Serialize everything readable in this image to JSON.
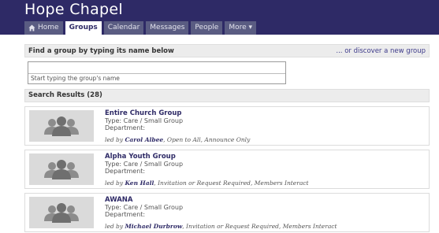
{
  "site": {
    "title": "Hope Chapel"
  },
  "nav": {
    "tabs": [
      {
        "label": "Home",
        "icon": "home-icon"
      },
      {
        "label": "Groups"
      },
      {
        "label": "Calendar"
      },
      {
        "label": "Messages"
      },
      {
        "label": "People"
      },
      {
        "label": "More ▾"
      }
    ],
    "active_tab": "Groups"
  },
  "find": {
    "label": "Find a group by typing its name below",
    "discover_link": "... or discover a new group",
    "input_value": "",
    "hint": "Start typing the group's name"
  },
  "results": {
    "header": "Search Results (28)",
    "items": [
      {
        "name": "Entire Church Group",
        "type": "Type: Care / Small Group",
        "department": "Department:",
        "led_by_prefix": "led by ",
        "leader": "Carol Albee",
        "details": ", Open to All, Announce Only"
      },
      {
        "name": "Alpha Youth Group",
        "type": "Type: Care / Small Group",
        "department": "Department:",
        "led_by_prefix": "led by ",
        "leader": "Ken Hall",
        "details": ", Invitation or Request Required, Members Interact"
      },
      {
        "name": "AWANA",
        "type": "Type: Care / Small Group",
        "department": "Department:",
        "led_by_prefix": "led by ",
        "leader": "Michael Durbrow",
        "details": ", Invitation or Request Required, Members Interact"
      }
    ]
  },
  "colors": {
    "header_bg": "#2e2a66",
    "tab_bg": "#5a5c82",
    "link": "#2e2a66",
    "bar_bg": "#ececec"
  }
}
